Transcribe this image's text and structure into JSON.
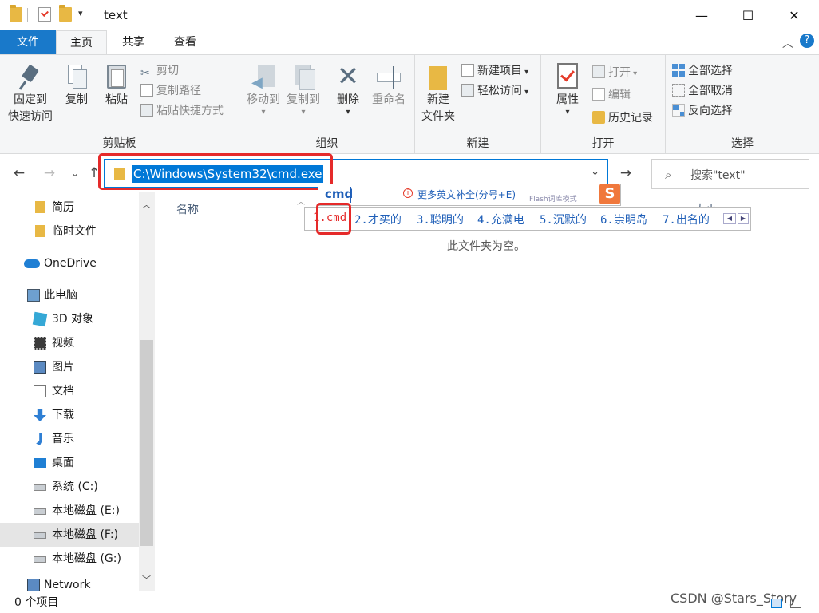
{
  "window": {
    "title": "text",
    "controls": {
      "minimize": "—",
      "maximize": "☐",
      "close": "✕"
    }
  },
  "tabs": [
    {
      "label": "文件"
    },
    {
      "label": "主页"
    },
    {
      "label": "共享"
    },
    {
      "label": "查看"
    }
  ],
  "ribbon": {
    "clipboard": {
      "group_label": "剪贴板",
      "pin_line1": "固定到",
      "pin_line2": "快速访问",
      "copy": "复制",
      "paste": "粘贴",
      "cut": "剪切",
      "copy_path": "复制路径",
      "paste_shortcut": "粘贴快捷方式"
    },
    "organize": {
      "group_label": "组织",
      "move_to": "移动到",
      "copy_to": "复制到",
      "delete": "删除",
      "rename": "重命名"
    },
    "new": {
      "group_label": "新建",
      "new_folder_line1": "新建",
      "new_folder_line2": "文件夹",
      "new_item": "新建项目",
      "easy_access": "轻松访问"
    },
    "open": {
      "group_label": "打开",
      "properties": "属性",
      "open": "打开",
      "edit": "编辑",
      "history": "历史记录"
    },
    "select": {
      "group_label": "选择",
      "select_all": "全部选择",
      "select_none": "全部取消",
      "invert": "反向选择"
    }
  },
  "address": {
    "path": "C:\\Windows\\System32\\cmd.exe",
    "search_placeholder": "搜索\"text\""
  },
  "sidebar": {
    "items": [
      {
        "label": "简历",
        "icon": "folder-icon"
      },
      {
        "label": "临时文件",
        "icon": "folder-icon"
      },
      {
        "label": "OneDrive",
        "icon": "cloud-icon"
      },
      {
        "label": "此电脑",
        "icon": "pc-icon"
      },
      {
        "label": "3D 对象",
        "icon": "cube-icon"
      },
      {
        "label": "视频",
        "icon": "film-icon"
      },
      {
        "label": "图片",
        "icon": "picture-icon"
      },
      {
        "label": "文档",
        "icon": "document-icon"
      },
      {
        "label": "下载",
        "icon": "download-icon"
      },
      {
        "label": "音乐",
        "icon": "music-icon"
      },
      {
        "label": "桌面",
        "icon": "desktop-icon"
      },
      {
        "label": "系统 (C:)",
        "icon": "drive-icon"
      },
      {
        "label": "本地磁盘 (E:)",
        "icon": "drive-icon"
      },
      {
        "label": "本地磁盘 (F:)",
        "icon": "drive-icon"
      },
      {
        "label": "本地磁盘 (G:)",
        "icon": "drive-icon"
      },
      {
        "label": "Network",
        "icon": "network-icon"
      }
    ]
  },
  "content": {
    "column_name": "名称",
    "column_size": "大小",
    "empty_text": "此文件夹为空。"
  },
  "ime": {
    "input": "cmd",
    "hint": "更多英文补全(分号+E)",
    "mode": "Flash词库模式",
    "logo": "S",
    "candidates": [
      "1.cmd",
      "2.才买的",
      "3.聪明的",
      "4.充满电",
      "5.沉默的",
      "6.崇明岛",
      "7.出名的"
    ]
  },
  "status": {
    "items_count": "0 个项目",
    "watermark": "CSDN @Stars_Story"
  },
  "colors": {
    "accent": "#1979ca",
    "highlight": "#e52a2a",
    "folder": "#e8b844"
  }
}
